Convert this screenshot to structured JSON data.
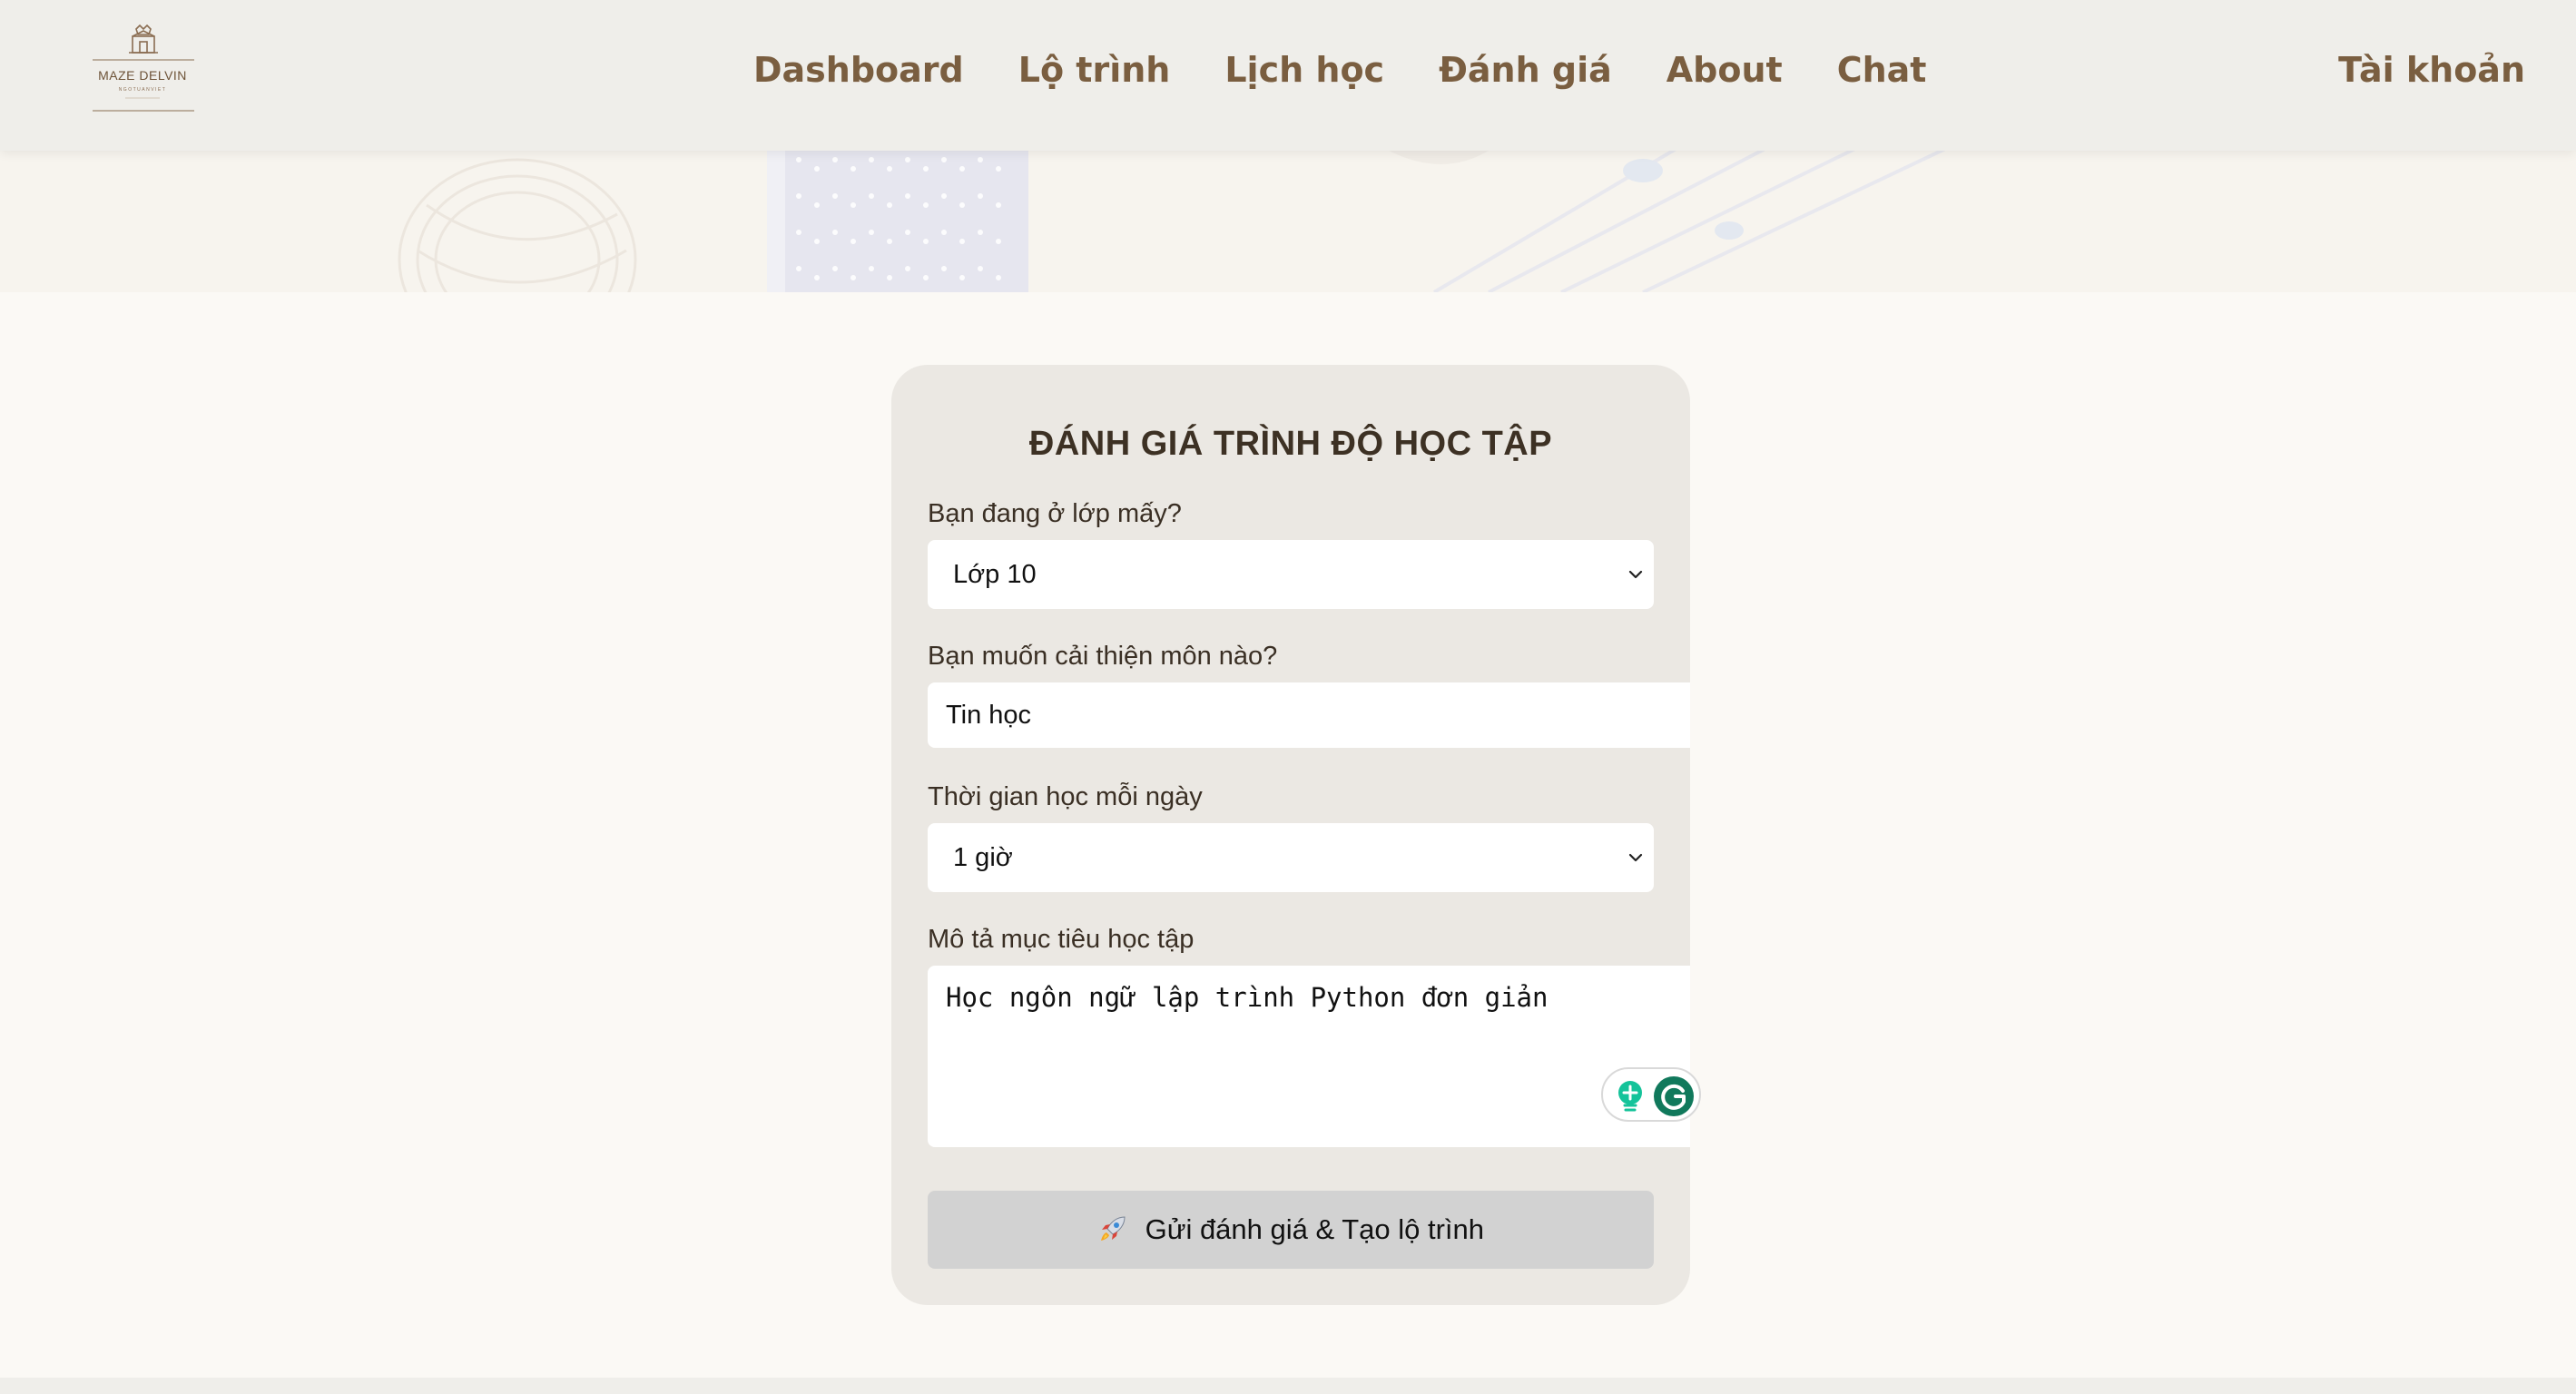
{
  "header": {
    "logo": {
      "brand": "MAZE DELVIN",
      "subtitle": "NGOTUANVIET"
    },
    "nav": [
      {
        "label": "Dashboard"
      },
      {
        "label": "Lộ trình"
      },
      {
        "label": "Lịch học"
      },
      {
        "label": "Đánh giá"
      },
      {
        "label": "About"
      },
      {
        "label": "Chat"
      }
    ],
    "account_label": "Tài khoản"
  },
  "form": {
    "title": "ĐÁNH GIÁ TRÌNH ĐỘ HỌC TẬP",
    "grade": {
      "label": "Bạn đang ở lớp mấy?",
      "value": "Lớp 10"
    },
    "subject": {
      "label": "Bạn muốn cải thiện môn nào?",
      "value": "Tin học"
    },
    "study_time": {
      "label": "Thời gian học mỗi ngày",
      "value": "1 giờ"
    },
    "goal": {
      "label": "Mô tả mục tiêu học tập",
      "value": "Học ngôn ngữ lập trình Python đơn giản"
    },
    "submit_label": "Gửi đánh giá & Tạo lộ trình"
  },
  "colors": {
    "nav_text": "#7a5e40",
    "header_bg": "#efeeea",
    "page_bg": "#fbf9f5",
    "card_bg": "#ebe8e3",
    "button_bg": "#d2d2d2",
    "grammarly_green": "#15c39a"
  },
  "icons": {
    "select_arrow": "chevron-down-icon",
    "submit": "rocket-icon",
    "grammarly": "grammarly-icon",
    "grammarly_assist": "lightbulb-icon"
  }
}
